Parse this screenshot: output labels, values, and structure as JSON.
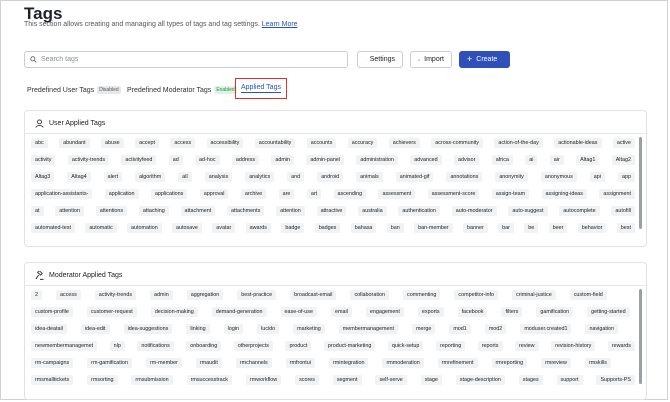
{
  "page": {
    "title": "Tags",
    "description": "This section allows creating and managing all types of tags and tag settings.",
    "learn_more": "Learn More"
  },
  "toolbar": {
    "search_placeholder": "Search tags",
    "settings_label": "Settings",
    "import_label": "Import",
    "create_label": "Create"
  },
  "tabs": [
    {
      "label": "Predefined User Tags",
      "badge": "Disabled"
    },
    {
      "label": "Predefined Moderator Tags",
      "badge": "Enabled"
    },
    {
      "label": "Applied Tags",
      "badge": ""
    }
  ],
  "user_section": {
    "title": "User Applied Tags",
    "rows": [
      [
        "abc",
        "abundant",
        "abuse",
        "accept",
        "access",
        "accessibility",
        "accountability",
        "accounts",
        "accuracy",
        "achievers",
        "across-community",
        "action-of-the-day",
        "actionable-ideas",
        "active"
      ],
      [
        "activity",
        "activity-trends",
        "activityfeed",
        "ad",
        "ad-hoc",
        "address",
        "admin",
        "admin-panel",
        "administration",
        "advanced",
        "advisor",
        "africa",
        "ai",
        "air",
        "Altag1",
        "Altag2"
      ],
      [
        "Altag3",
        "Altag4",
        "alert",
        "algorithm",
        "all",
        "analysis",
        "analytics",
        "and",
        "android",
        "animals",
        "animated-gif",
        "annotations",
        "anonymity",
        "anonymous",
        "api",
        "app"
      ],
      [
        "application-assistants-",
        "application",
        "applications",
        "approval",
        "archive",
        "are",
        "art",
        "ascending",
        "assessment",
        "assessment-score",
        "assign-team",
        "assigning-ideas",
        "assignment"
      ],
      [
        "at",
        "attention",
        "attentions",
        "attaching",
        "attachment",
        "attachments",
        "attention",
        "attractive",
        "australia",
        "authentication",
        "auto-moderator",
        "auto-suggest",
        "autocomplete",
        "autofill"
      ],
      [
        "automated-test",
        "automatic",
        "automation",
        "autosave",
        "avatar",
        "awards",
        "badge",
        "badges",
        "bahasa",
        "ban",
        "ban-member",
        "banner",
        "bar",
        "be",
        "beer",
        "behavior",
        "best"
      ]
    ]
  },
  "mod_section": {
    "title": "Moderator Applied Tags",
    "rows": [
      [
        "2",
        "access",
        "activity-trends",
        "admin",
        "aggregation",
        "best-practice",
        "broadcast-email",
        "collaboration",
        "commenting",
        "competitor-info",
        "criminal-justice",
        "custom-field"
      ],
      [
        "custom-profile",
        "customer-request",
        "decision-making",
        "demand-generation",
        "ease-of-use",
        "email",
        "engagement",
        "exports",
        "facebook",
        "filters",
        "gamification",
        "getting-started"
      ],
      [
        "idea-deatail",
        "idea-edit",
        "idea-suggestions",
        "linking",
        "login",
        "lucido",
        "marketing",
        "membermanagement",
        "merge",
        "mod1",
        "mod2",
        "moduser.created1",
        "navigation"
      ],
      [
        "newmembermanagemet",
        "nlp",
        "notifications",
        "onboarding",
        "otherprojects",
        "product",
        "product-marketing",
        "quick-setup",
        "reporting",
        "reports",
        "review",
        "revision-history",
        "rewards"
      ],
      [
        "rm-campaigns",
        "rm-gamification",
        "rm-member",
        "rmaudit",
        "rmchannels",
        "rmfrontui",
        "rmintegration",
        "rmmoderation",
        "rmrefinement",
        "rmreporting",
        "rmreview",
        "rmskills"
      ],
      [
        "rmsmalltickets",
        "rmsorting",
        "rmsubmission",
        "rmsuccesstrack",
        "rmworkflow",
        "scores",
        "segment",
        "self-serve",
        "stage",
        "stage-description",
        "stages",
        "support",
        "Supports-PS"
      ]
    ]
  }
}
